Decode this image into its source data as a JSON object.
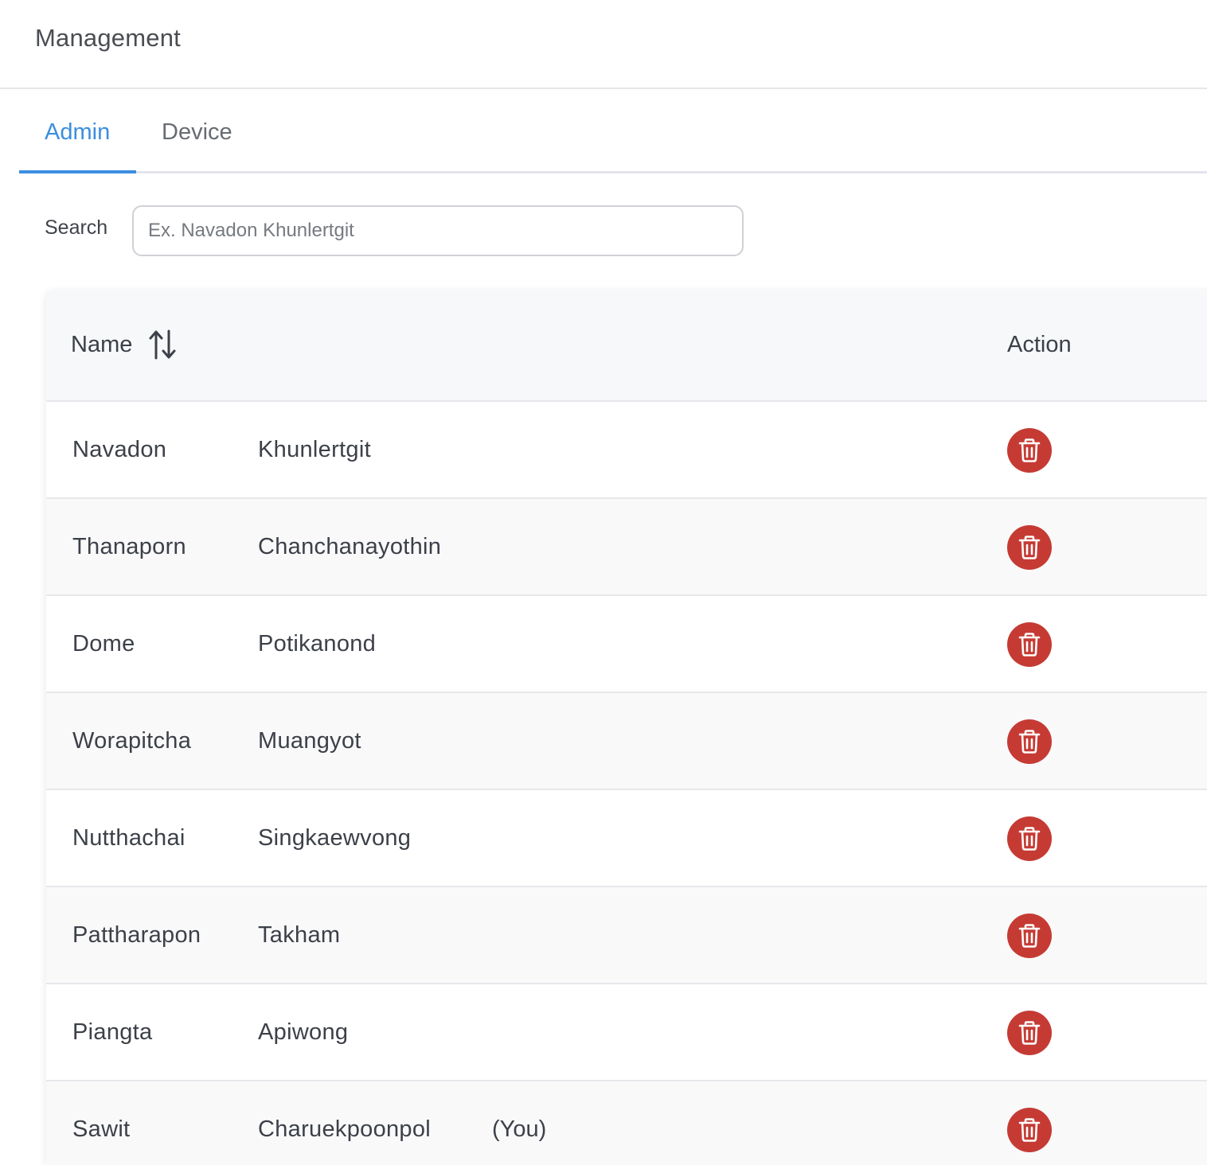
{
  "header": {
    "title": "Management"
  },
  "tabs": [
    {
      "label": "Admin",
      "active": true
    },
    {
      "label": "Device",
      "active": false
    }
  ],
  "search": {
    "label": "Search",
    "placeholder": "Ex. Navadon Khunlertgit",
    "value": ""
  },
  "table": {
    "columns": {
      "name": "Name",
      "action": "Action"
    },
    "rows": [
      {
        "first": "Navadon",
        "last": "Khunlertgit",
        "note": ""
      },
      {
        "first": "Thanaporn",
        "last": "Chanchanayothin",
        "note": ""
      },
      {
        "first": "Dome",
        "last": "Potikanond",
        "note": ""
      },
      {
        "first": "Worapitcha",
        "last": "Muangyot",
        "note": ""
      },
      {
        "first": "Nutthachai",
        "last": "Singkaewvong",
        "note": ""
      },
      {
        "first": "Pattharapon",
        "last": "Takham",
        "note": ""
      },
      {
        "first": "Piangta",
        "last": "Apiwong",
        "note": ""
      },
      {
        "first": "Sawit",
        "last": "Charuekpoonpol",
        "note": "(You)"
      }
    ]
  },
  "colors": {
    "accent": "#3b8ee0",
    "delete": "#c53b34"
  },
  "icons": {
    "sort": "sort-up-down-icon",
    "delete": "trash-icon"
  }
}
